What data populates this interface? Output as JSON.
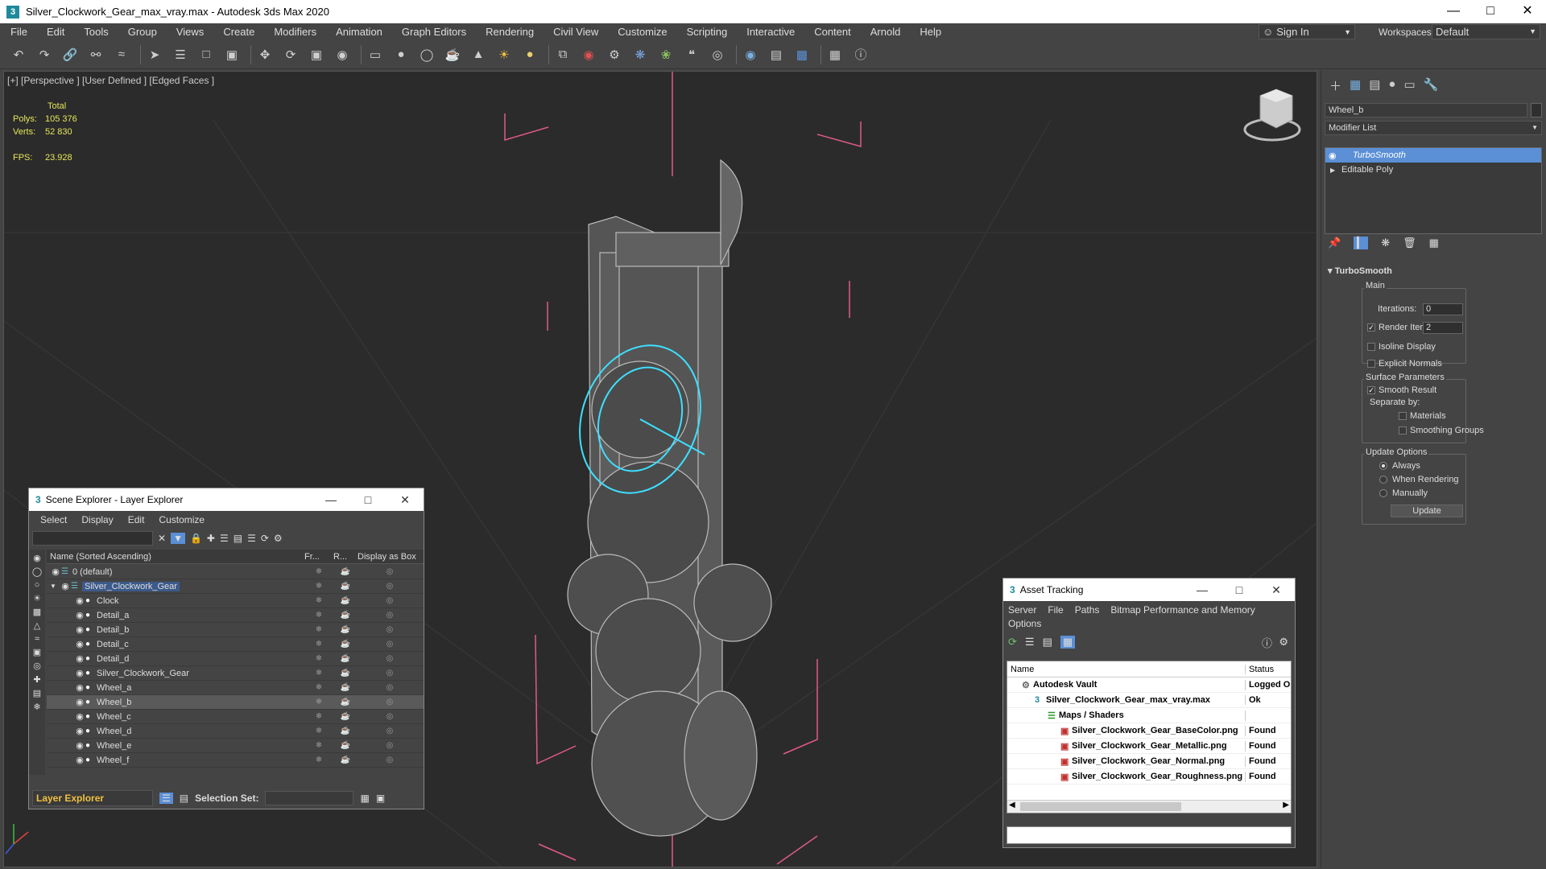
{
  "title": {
    "text": "Silver_Clockwork_Gear_max_vray.max - Autodesk 3ds Max 2020",
    "icon": "3"
  },
  "menu": [
    "File",
    "Edit",
    "Tools",
    "Group",
    "Views",
    "Create",
    "Modifiers",
    "Animation",
    "Graph Editors",
    "Rendering",
    "Civil View",
    "Customize",
    "Scripting",
    "Interactive",
    "Content",
    "Arnold",
    "Help"
  ],
  "signin": "Sign In",
  "workspaces": {
    "label": "Workspaces:",
    "value": "Default"
  },
  "viewport": {
    "label": "[+] [Perspective ] [User Defined ] [Edged Faces ]",
    "stats": {
      "total_label": "Total",
      "polys_label": "Polys:",
      "polys": "105 376",
      "verts_label": "Verts:",
      "verts": "52 830",
      "fps_label": "FPS:",
      "fps": "23.928"
    }
  },
  "cmd_panel": {
    "object_name": "Wheel_b",
    "modifier_list": "Modifier List",
    "stack": [
      "TurboSmooth",
      "Editable Poly"
    ],
    "rollout_title": "TurboSmooth",
    "main_label": "Main",
    "iterations_label": "Iterations:",
    "iterations": "0",
    "render_iters_label": "Render Iters:",
    "render_iters": "2",
    "isoline": "Isoline Display",
    "explicit": "Explicit Normals",
    "surface_params": "Surface Parameters",
    "smooth_result": "Smooth Result",
    "separate_by": "Separate by:",
    "materials": "Materials",
    "smoothing_groups": "Smoothing Groups",
    "update_options": "Update Options",
    "always": "Always",
    "when_rendering": "When Rendering",
    "manually": "Manually",
    "update_btn": "Update"
  },
  "scene_explorer": {
    "title": "Scene Explorer - Layer Explorer",
    "menu": [
      "Select",
      "Display",
      "Edit",
      "Customize"
    ],
    "columns": [
      "Name (Sorted Ascending)",
      "Fr...",
      "R...",
      "Display as Box"
    ],
    "rows": [
      {
        "name": "0 (default)",
        "indent": 0
      },
      {
        "name": "Silver_Clockwork_Gear",
        "indent": 0,
        "selected": true
      },
      {
        "name": "Clock",
        "indent": 1
      },
      {
        "name": "Detail_a",
        "indent": 1
      },
      {
        "name": "Detail_b",
        "indent": 1
      },
      {
        "name": "Detail_c",
        "indent": 1
      },
      {
        "name": "Detail_d",
        "indent": 1
      },
      {
        "name": "Silver_Clockwork_Gear",
        "indent": 1
      },
      {
        "name": "Wheel_a",
        "indent": 1
      },
      {
        "name": "Wheel_b",
        "indent": 1,
        "highlight": true
      },
      {
        "name": "Wheel_c",
        "indent": 1
      },
      {
        "name": "Wheel_d",
        "indent": 1
      },
      {
        "name": "Wheel_e",
        "indent": 1
      },
      {
        "name": "Wheel_f",
        "indent": 1
      }
    ],
    "footer_explorer": "Layer Explorer",
    "selection_set_label": "Selection Set:"
  },
  "asset_tracking": {
    "title": "Asset Tracking",
    "menu": [
      "Server",
      "File",
      "Paths",
      "Bitmap Performance and Memory"
    ],
    "menu2": "Options",
    "columns": [
      "Name",
      "Status"
    ],
    "rows": [
      {
        "name": "Autodesk Vault",
        "status": "Logged O",
        "indent": 0
      },
      {
        "name": "Silver_Clockwork_Gear_max_vray.max",
        "status": "Ok",
        "indent": 1
      },
      {
        "name": "Maps / Shaders",
        "status": "",
        "indent": 2
      },
      {
        "name": "Silver_Clockwork_Gear_BaseColor.png",
        "status": "Found",
        "indent": 3
      },
      {
        "name": "Silver_Clockwork_Gear_Metallic.png",
        "status": "Found",
        "indent": 3
      },
      {
        "name": "Silver_Clockwork_Gear_Normal.png",
        "status": "Found",
        "indent": 3
      },
      {
        "name": "Silver_Clockwork_Gear_Roughness.png",
        "status": "Found",
        "indent": 3
      }
    ]
  },
  "colors": {
    "accent": "#5b8fd6",
    "selection_cyan": "#3de0ff",
    "bbox_pink": "#e05a8a"
  }
}
